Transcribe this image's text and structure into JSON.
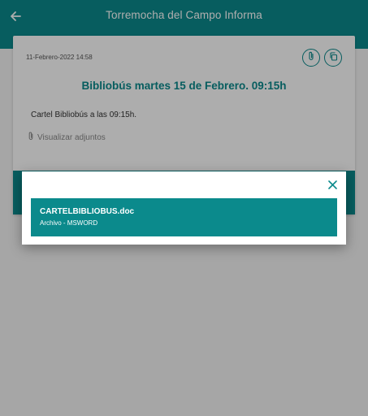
{
  "appbar": {
    "title": "Torremocha del Campo Informa",
    "back_icon": "arrow-left-icon"
  },
  "notice": {
    "date": "11-Febrero-2022 14:58",
    "headline": "Bibliobús martes 15 de Febrero.  09:15h",
    "body": "Cartel Bibliobús a las 09:15h.",
    "attachments_link": "Visualizar adjuntos",
    "icons": [
      "paperclip-icon",
      "copy-icon"
    ]
  },
  "dialog": {
    "close_icon": "close-icon",
    "files": [
      {
        "name": "CARTELBIBLIOBUS.doc",
        "type": "Archivo - MSWORD"
      }
    ]
  },
  "colors": {
    "primary": "#0b8a8c",
    "overlay": "rgba(0,0,0,0.32)"
  }
}
